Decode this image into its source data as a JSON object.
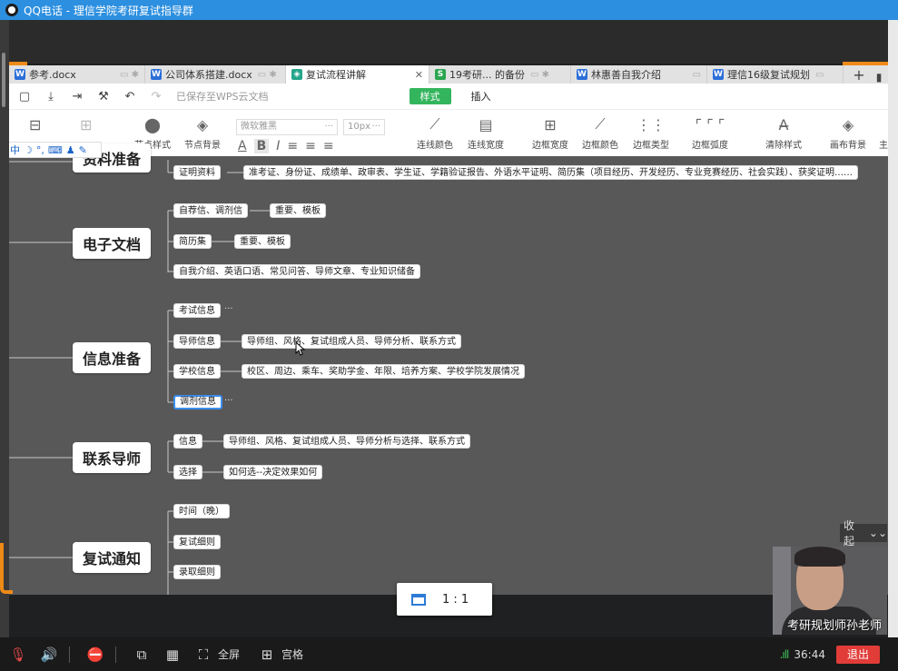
{
  "qq_window": {
    "title": "QQ电话 - 理信学院考研复试指导群"
  },
  "tabs": [
    {
      "label": "参考.docx",
      "icon": "W",
      "active": false
    },
    {
      "label": "公司体系搭建.docx",
      "icon": "W",
      "active": false
    },
    {
      "label": "复试流程讲解",
      "icon": "M",
      "active": true
    },
    {
      "label": "19考研... 的备份",
      "icon": "S",
      "active": false
    },
    {
      "label": "林惠善自我介绍",
      "icon": "W",
      "active": false
    },
    {
      "label": "理信16级复试规划",
      "icon": "W",
      "active": false
    }
  ],
  "toolbar1": {
    "saved_status": "已保存至WPS云文档",
    "mode_style": "样式",
    "mode_insert": "插入"
  },
  "toolbar2": {
    "node_style": "节点样式",
    "node_bg": "节点背景",
    "font_name": "微软雅黑",
    "font_size": "10px",
    "line_color": "连线颜色",
    "line_width": "连线宽度",
    "border_width": "边框宽度",
    "border_color": "边框颜色",
    "border_type": "边框类型",
    "border_radius": "边框弧度",
    "clear_style": "清除样式",
    "canvas_bg": "画布背景",
    "theme_partial": "主"
  },
  "ime": {
    "mode": "中"
  },
  "mindmap": {
    "nodes": [
      {
        "title": "资料准备",
        "children": [
          {
            "label": "证明资料",
            "detail": "准考证、身份证、成绩单、政审表、学生证、学籍验证报告、外语水平证明、简历集（项目经历、开发经历、专业竞赛经历、社会实践）、获奖证明……"
          }
        ]
      },
      {
        "title": "电子文档",
        "children": [
          {
            "label": "自荐信、调剂信",
            "detail": "重要、模板"
          },
          {
            "label": "简历集",
            "detail": "重要、模板"
          },
          {
            "label": "自我介绍、英语口语、常见问答、导师文章、专业知识储备",
            "detail": ""
          }
        ]
      },
      {
        "title": "信息准备",
        "children": [
          {
            "label": "考试信息",
            "detail": "···"
          },
          {
            "label": "导师信息",
            "detail": "导师组、风格、复试组成人员、导师分析、联系方式"
          },
          {
            "label": "学校信息",
            "detail": "校区、周边、乘车、奖助学金、年限、培养方案、学校学院发展情况"
          },
          {
            "label": "调剂信息",
            "detail": "···"
          }
        ]
      },
      {
        "title": "联系导师",
        "children": [
          {
            "label": "信息",
            "detail": "导师组、风格、复试组成人员、导师分析与选择、联系方式"
          },
          {
            "label": "选择",
            "detail": "如何选--决定效果如何"
          }
        ]
      },
      {
        "title": "复试通知",
        "children": [
          {
            "label": "时间（晚）",
            "detail": ""
          },
          {
            "label": "复试细则",
            "detail": ""
          },
          {
            "label": "录取细则",
            "detail": ""
          }
        ]
      }
    ]
  },
  "collapse_label": "收起",
  "zoom_popup": {
    "ratio": "1 : 1"
  },
  "video": {
    "caption": "考研规划师孙老师"
  },
  "bottom_bar": {
    "fullscreen": "全屏",
    "grid": "宫格",
    "timer": "36:44",
    "exit": "退出"
  },
  "colors": {
    "accent_blue": "#2c8fe0",
    "wps_green": "#33b55d",
    "canvas_bg": "#595859",
    "orange": "#ee8a17",
    "exit_red": "#e13c38"
  }
}
